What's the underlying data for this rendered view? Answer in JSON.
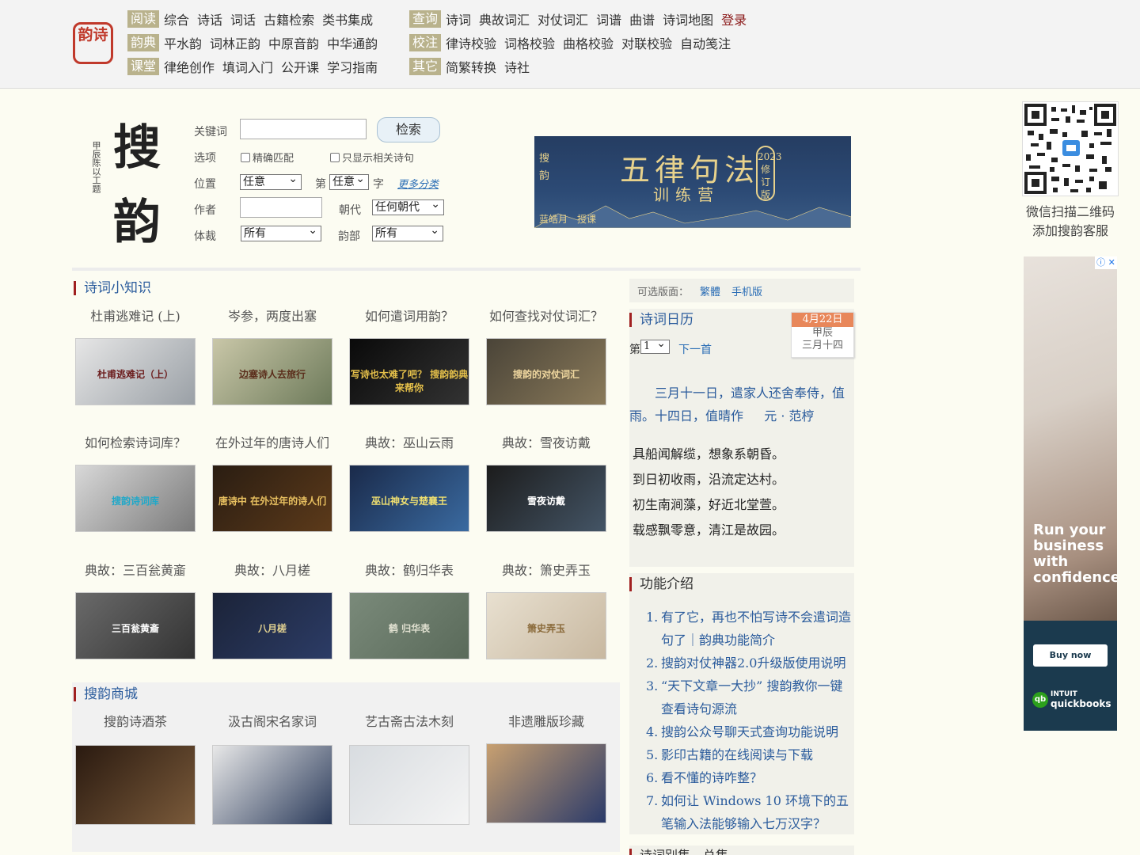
{
  "seal_text": "韵诗",
  "nav": {
    "rows_left": [
      {
        "cat": "阅读",
        "items": [
          "综合",
          "诗话",
          "词话",
          "古籍检索",
          "类书集成"
        ]
      },
      {
        "cat": "韵典",
        "items": [
          "平水韵",
          "词林正韵",
          "中原音韵",
          "中华通韵"
        ]
      },
      {
        "cat": "课堂",
        "items": [
          "律绝创作",
          "填词入门",
          "公开课",
          "学习指南"
        ]
      }
    ],
    "rows_right": [
      {
        "cat": "查询",
        "items": [
          "诗词",
          "典故词汇",
          "对仗词汇",
          "词谱",
          "曲谱",
          "诗词地图"
        ],
        "login": "登录"
      },
      {
        "cat": "校注",
        "items": [
          "律诗校验",
          "词格校验",
          "曲格校验",
          "对联校验",
          "自动笺注"
        ]
      },
      {
        "cat": "其它",
        "items": [
          "简繁转换",
          "诗社"
        ]
      }
    ]
  },
  "logo": {
    "big": "搜韵",
    "small": "甲辰陈以工题"
  },
  "search": {
    "keyword_label": "关键词",
    "keyword_value": "",
    "search_button": "检索",
    "options_label": "选项",
    "exact_match": "精确匹配",
    "only_related": "只显示相关诗句",
    "position_label": "位置",
    "position_value": "任意",
    "nth_label": "第",
    "nth_value": "任意",
    "char_label": "字",
    "more_categories": "更多分类",
    "author_label": "作者",
    "author_value": "",
    "dynasty_label": "朝代",
    "dynasty_value": "任何朝代",
    "genre_label": "体裁",
    "genre_value": "所有",
    "rhyme_label": "韵部",
    "rhyme_value": "所有"
  },
  "banner": {
    "title": "五律句法",
    "subtitle": "训练营",
    "side": "搜韵",
    "version": "2023修订版",
    "teacher": "蓝皓月　授课"
  },
  "knowledge": {
    "heading": "诗词小知识",
    "items": [
      {
        "title": "杜甫逃难记 (上)",
        "caption": "杜甫逃难记（上）"
      },
      {
        "title": "岑参，两度出塞",
        "caption": "边塞诗人去旅行"
      },
      {
        "title": "如何遣词用韵？",
        "caption": "写诗也太难了吧？ 搜韵韵典来帮你"
      },
      {
        "title": "如何查找对仗词汇？",
        "caption": "搜韵的对仗词汇"
      },
      {
        "title": "如何检索诗词库？",
        "caption": "搜韵诗词库"
      },
      {
        "title": "在外过年的唐诗人们",
        "caption": "唐诗中 在外过年的诗人们"
      },
      {
        "title": "典故：巫山云雨",
        "caption": "巫山神女与楚襄王"
      },
      {
        "title": "典故：雪夜访戴",
        "caption": "雪夜访戴"
      },
      {
        "title": "典故：三百瓮黄齑",
        "caption": "三百瓮黄齑"
      },
      {
        "title": "典故：八月槎",
        "caption": "八月槎"
      },
      {
        "title": "典故：鹤归华表",
        "caption": "鹤 归华表"
      },
      {
        "title": "典故：箫史弄玉",
        "caption": "箫史弄玉"
      }
    ]
  },
  "shop": {
    "heading": "搜韵商城",
    "items": [
      "搜韵诗酒茶",
      "汲古阁宋名家词",
      "艺古斋古法木刻",
      "非遗雕版珍藏"
    ]
  },
  "versions": {
    "label": "可选版面：",
    "traditional": "繁體",
    "mobile": "手机版"
  },
  "calendar": {
    "heading": "诗词日历",
    "date": "4月22日",
    "ganzhi": "甲辰",
    "lunar": "三月十四",
    "nth_prefix": "第",
    "nth_value": "1",
    "next": "下一首"
  },
  "poem": {
    "intro": "三月十一日，遣家人还舍奉侍，值雨。十四日，值晴作",
    "dynasty": "元",
    "sep": "·",
    "author": "范梈",
    "lines": [
      "具船闻解缆，想象系朝昏。",
      "到日初收雨，沿流定达村。",
      "初生南涧藻，好近北堂萱。",
      "载感飘零意，清江是故园。"
    ]
  },
  "features": {
    "heading": "功能介绍",
    "items": [
      "有了它，再也不怕写诗不会遣词造句了｜韵典功能简介",
      "搜韵对仗神器2.0升级版使用说明",
      "“天下文章一大抄” 搜韵教你一键查看诗句源流",
      "搜韵公众号聊天式查询功能说明",
      "影印古籍的在线阅读与下载",
      "看不懂的诗咋整？",
      "如何让 Windows 10 环境下的五笔输入法能够输入七万汉字？"
    ],
    "next_heading": "诗词别集　总集"
  },
  "qr": {
    "line1": "微信扫描二维码",
    "line2": "添加搜韵客服"
  },
  "ad": {
    "headline": "Run your business with confidence",
    "cta": "Buy now",
    "brand_small": "INTUIT",
    "brand": "quickbooks",
    "badge": "ⓘ ✕"
  }
}
